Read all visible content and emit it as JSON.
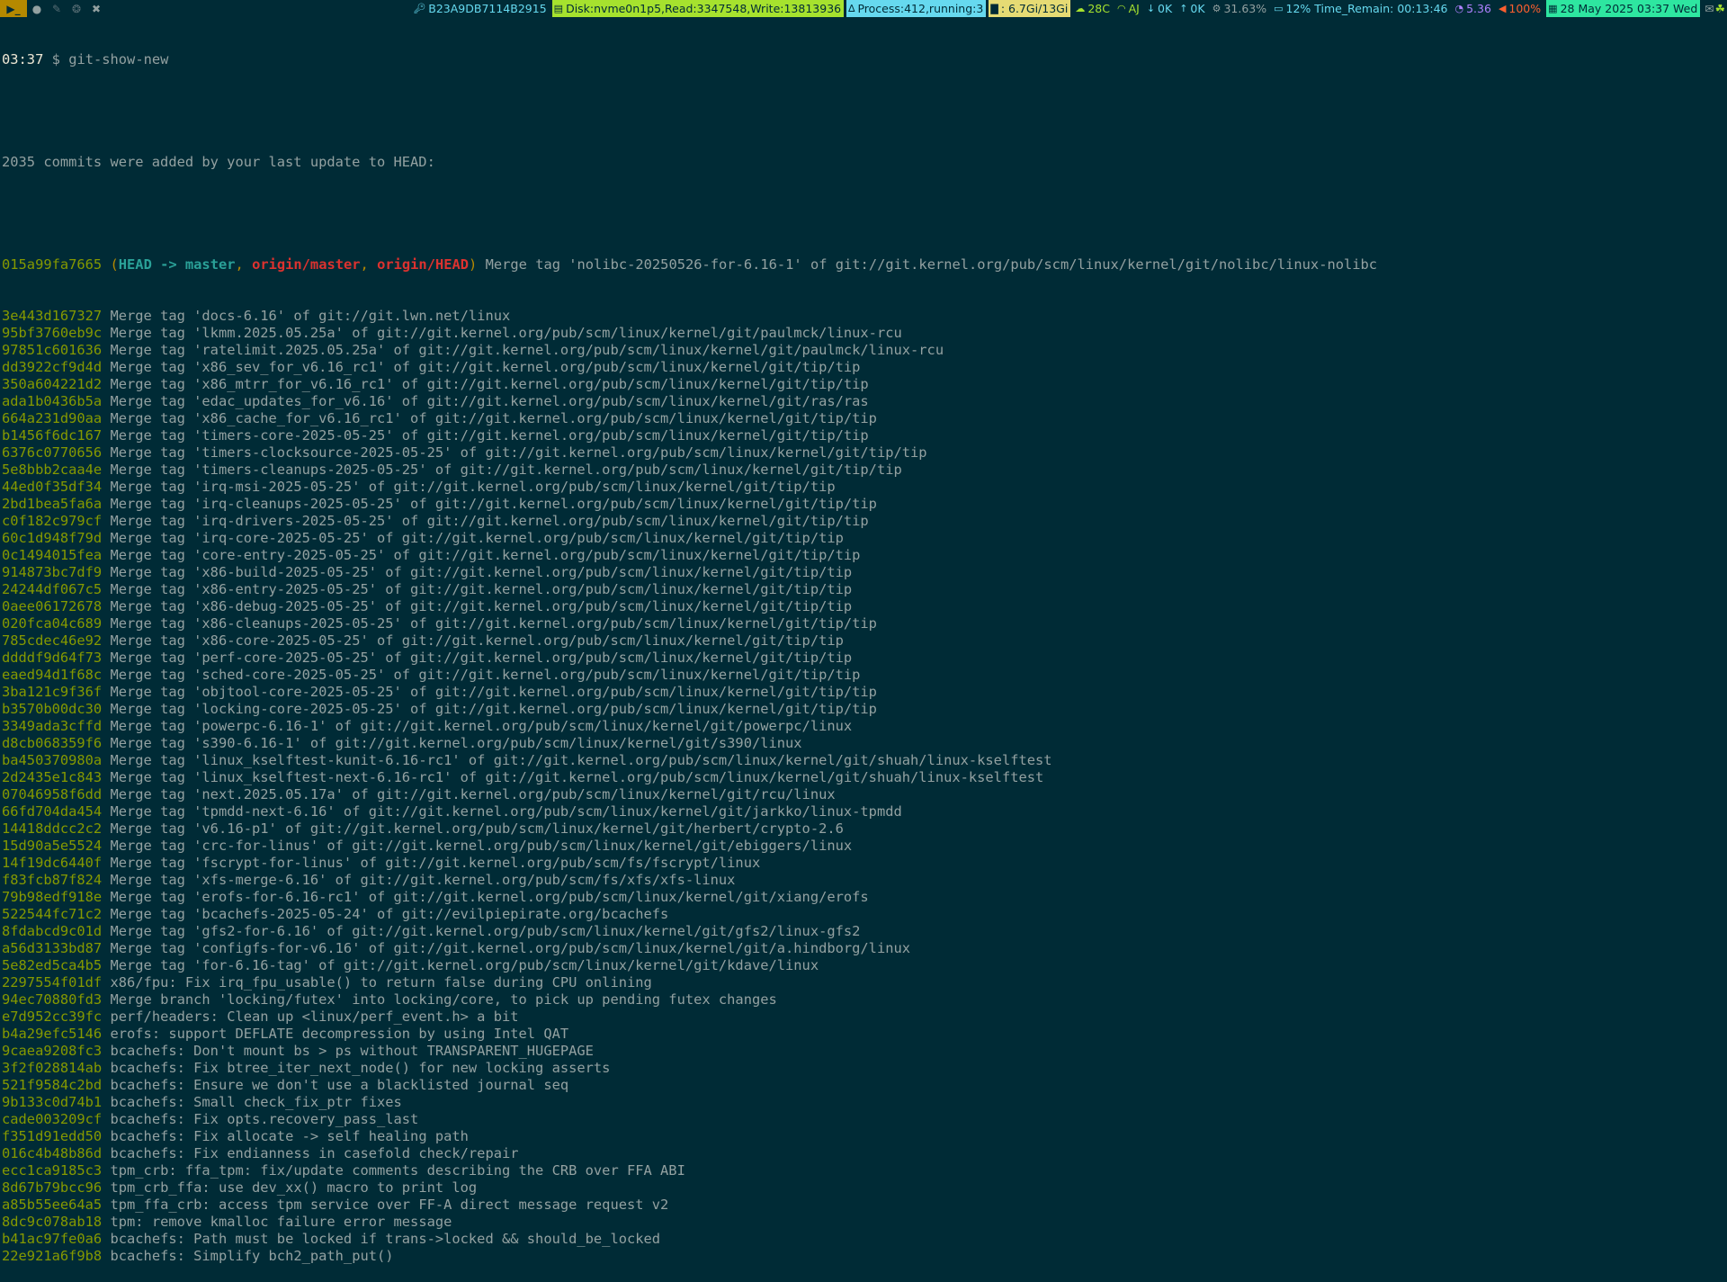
{
  "statusbar": {
    "workspaces": [
      {
        "glyph": "▶_",
        "state": "active",
        "icon": "terminal-icon"
      },
      {
        "glyph": "●",
        "state": "idle",
        "icon": "browser-icon"
      },
      {
        "glyph": "✎",
        "state": "dim",
        "icon": "editor-icon"
      },
      {
        "glyph": "❂",
        "state": "dim",
        "icon": "linux-icon"
      },
      {
        "glyph": "✖",
        "state": "idle",
        "icon": "tools-icon"
      }
    ],
    "key_id": "B23A9DB7114B2915",
    "disk": "Disk:nvme0n1p5,Read:3347548,Write:13813936",
    "process": "Process:412,running:3",
    "memory": ": 6.7Gi/13Gi",
    "temperature": "28C",
    "wifi": "AJ",
    "net_down": "0K",
    "net_up": "0K",
    "cpu": "31.63%",
    "battery": "12% Time_Remain: 00:13:46",
    "load": "5.36",
    "volume": "100%",
    "datetime": "28 May 2025 03:37 Wed",
    "colors": {
      "disk_bg": "#a6e22e",
      "process_bg": "#66d9ef",
      "memory_bg": "#e6db74",
      "datetime_bg": "#2ee6a0"
    }
  },
  "terminal": {
    "prompt_time": "03:37",
    "prompt_symbol": "$",
    "command": "git-show-new",
    "summary": "2035 commits were added by your last update to HEAD:",
    "head_commit": {
      "hash": "015a99fa7665",
      "open": "(",
      "head": "HEAD -> master",
      "sep1": ",",
      "remote1": "origin/master",
      "sep2": ",",
      "remote2": "origin/HEAD",
      "close": ")",
      "message": "Merge tag 'nolibc-20250526-for-6.16-1' of git://git.kernel.org/pub/scm/linux/kernel/git/nolibc/linux-nolibc"
    },
    "commits": [
      {
        "hash": "3e443d167327",
        "message": "Merge tag 'docs-6.16' of git://git.lwn.net/linux"
      },
      {
        "hash": "95bf3760eb9c",
        "message": "Merge tag 'lkmm.2025.05.25a' of git://git.kernel.org/pub/scm/linux/kernel/git/paulmck/linux-rcu"
      },
      {
        "hash": "97851c601636",
        "message": "Merge tag 'ratelimit.2025.05.25a' of git://git.kernel.org/pub/scm/linux/kernel/git/paulmck/linux-rcu"
      },
      {
        "hash": "dd3922cf9d4d",
        "message": "Merge tag 'x86_sev_for_v6.16_rc1' of git://git.kernel.org/pub/scm/linux/kernel/git/tip/tip"
      },
      {
        "hash": "350a604221d2",
        "message": "Merge tag 'x86_mtrr_for_v6.16_rc1' of git://git.kernel.org/pub/scm/linux/kernel/git/tip/tip"
      },
      {
        "hash": "ada1b0436b5a",
        "message": "Merge tag 'edac_updates_for_v6.16' of git://git.kernel.org/pub/scm/linux/kernel/git/ras/ras"
      },
      {
        "hash": "664a231d90aa",
        "message": "Merge tag 'x86_cache_for_v6.16_rc1' of git://git.kernel.org/pub/scm/linux/kernel/git/tip/tip"
      },
      {
        "hash": "b1456f6dc167",
        "message": "Merge tag 'timers-core-2025-05-25' of git://git.kernel.org/pub/scm/linux/kernel/git/tip/tip"
      },
      {
        "hash": "6376c0770656",
        "message": "Merge tag 'timers-clocksource-2025-05-25' of git://git.kernel.org/pub/scm/linux/kernel/git/tip/tip"
      },
      {
        "hash": "5e8bbb2caa4e",
        "message": "Merge tag 'timers-cleanups-2025-05-25' of git://git.kernel.org/pub/scm/linux/kernel/git/tip/tip"
      },
      {
        "hash": "44ed0f35df34",
        "message": "Merge tag 'irq-msi-2025-05-25' of git://git.kernel.org/pub/scm/linux/kernel/git/tip/tip"
      },
      {
        "hash": "2bd1bea5fa6a",
        "message": "Merge tag 'irq-cleanups-2025-05-25' of git://git.kernel.org/pub/scm/linux/kernel/git/tip/tip"
      },
      {
        "hash": "c0f182c979cf",
        "message": "Merge tag 'irq-drivers-2025-05-25' of git://git.kernel.org/pub/scm/linux/kernel/git/tip/tip"
      },
      {
        "hash": "60c1d948f79d",
        "message": "Merge tag 'irq-core-2025-05-25' of git://git.kernel.org/pub/scm/linux/kernel/git/tip/tip"
      },
      {
        "hash": "0c1494015fea",
        "message": "Merge tag 'core-entry-2025-05-25' of git://git.kernel.org/pub/scm/linux/kernel/git/tip/tip"
      },
      {
        "hash": "914873bc7df9",
        "message": "Merge tag 'x86-build-2025-05-25' of git://git.kernel.org/pub/scm/linux/kernel/git/tip/tip"
      },
      {
        "hash": "24244df067c5",
        "message": "Merge tag 'x86-entry-2025-05-25' of git://git.kernel.org/pub/scm/linux/kernel/git/tip/tip"
      },
      {
        "hash": "0aee06172678",
        "message": "Merge tag 'x86-debug-2025-05-25' of git://git.kernel.org/pub/scm/linux/kernel/git/tip/tip"
      },
      {
        "hash": "020fca04c689",
        "message": "Merge tag 'x86-cleanups-2025-05-25' of git://git.kernel.org/pub/scm/linux/kernel/git/tip/tip"
      },
      {
        "hash": "785cdec46e92",
        "message": "Merge tag 'x86-core-2025-05-25' of git://git.kernel.org/pub/scm/linux/kernel/git/tip/tip"
      },
      {
        "hash": "ddddf9d64f73",
        "message": "Merge tag 'perf-core-2025-05-25' of git://git.kernel.org/pub/scm/linux/kernel/git/tip/tip"
      },
      {
        "hash": "eaed94d1f68c",
        "message": "Merge tag 'sched-core-2025-05-25' of git://git.kernel.org/pub/scm/linux/kernel/git/tip/tip"
      },
      {
        "hash": "3ba121c9f36f",
        "message": "Merge tag 'objtool-core-2025-05-25' of git://git.kernel.org/pub/scm/linux/kernel/git/tip/tip"
      },
      {
        "hash": "b3570b00dc30",
        "message": "Merge tag 'locking-core-2025-05-25' of git://git.kernel.org/pub/scm/linux/kernel/git/tip/tip"
      },
      {
        "hash": "3349ada3cffd",
        "message": "Merge tag 'powerpc-6.16-1' of git://git.kernel.org/pub/scm/linux/kernel/git/powerpc/linux"
      },
      {
        "hash": "d8cb068359f6",
        "message": "Merge tag 's390-6.16-1' of git://git.kernel.org/pub/scm/linux/kernel/git/s390/linux"
      },
      {
        "hash": "ba450370980a",
        "message": "Merge tag 'linux_kselftest-kunit-6.16-rc1' of git://git.kernel.org/pub/scm/linux/kernel/git/shuah/linux-kselftest"
      },
      {
        "hash": "2d2435e1c843",
        "message": "Merge tag 'linux_kselftest-next-6.16-rc1' of git://git.kernel.org/pub/scm/linux/kernel/git/shuah/linux-kselftest"
      },
      {
        "hash": "07046958f6dd",
        "message": "Merge tag 'next.2025.05.17a' of git://git.kernel.org/pub/scm/linux/kernel/git/rcu/linux"
      },
      {
        "hash": "66fd704da454",
        "message": "Merge tag 'tpmdd-next-6.16' of git://git.kernel.org/pub/scm/linux/kernel/git/jarkko/linux-tpmdd"
      },
      {
        "hash": "14418ddcc2c2",
        "message": "Merge tag 'v6.16-p1' of git://git.kernel.org/pub/scm/linux/kernel/git/herbert/crypto-2.6"
      },
      {
        "hash": "15d90a5e5524",
        "message": "Merge tag 'crc-for-linus' of git://git.kernel.org/pub/scm/linux/kernel/git/ebiggers/linux"
      },
      {
        "hash": "14f19dc6440f",
        "message": "Merge tag 'fscrypt-for-linus' of git://git.kernel.org/pub/scm/fs/fscrypt/linux"
      },
      {
        "hash": "f83fcb87f824",
        "message": "Merge tag 'xfs-merge-6.16' of git://git.kernel.org/pub/scm/fs/xfs/xfs-linux"
      },
      {
        "hash": "79b98edf918e",
        "message": "Merge tag 'erofs-for-6.16-rc1' of git://git.kernel.org/pub/scm/linux/kernel/git/xiang/erofs"
      },
      {
        "hash": "522544fc71c2",
        "message": "Merge tag 'bcachefs-2025-05-24' of git://evilpiepirate.org/bcachefs"
      },
      {
        "hash": "8fdabcd9c01d",
        "message": "Merge tag 'gfs2-for-6.16' of git://git.kernel.org/pub/scm/linux/kernel/git/gfs2/linux-gfs2"
      },
      {
        "hash": "a56d3133bd87",
        "message": "Merge tag 'configfs-for-v6.16' of git://git.kernel.org/pub/scm/linux/kernel/git/a.hindborg/linux"
      },
      {
        "hash": "5e82ed5ca4b5",
        "message": "Merge tag 'for-6.16-tag' of git://git.kernel.org/pub/scm/linux/kernel/git/kdave/linux"
      },
      {
        "hash": "2297554f01df",
        "message": "x86/fpu: Fix irq_fpu_usable() to return false during CPU onlining"
      },
      {
        "hash": "94ec70880fd3",
        "message": "Merge branch 'locking/futex' into locking/core, to pick up pending futex changes"
      },
      {
        "hash": "e7d952cc39fc",
        "message": "perf/headers: Clean up <linux/perf_event.h> a bit"
      },
      {
        "hash": "b4a29efc5146",
        "message": "erofs: support DEFLATE decompression by using Intel QAT"
      },
      {
        "hash": "9caea9208fc3",
        "message": "bcachefs: Don't mount bs > ps without TRANSPARENT_HUGEPAGE"
      },
      {
        "hash": "3f2f028814ab",
        "message": "bcachefs: Fix btree_iter_next_node() for new locking asserts"
      },
      {
        "hash": "521f9584c2bd",
        "message": "bcachefs: Ensure we don't use a blacklisted journal seq"
      },
      {
        "hash": "9b133c0d74b1",
        "message": "bcachefs: Small check_fix_ptr fixes"
      },
      {
        "hash": "cade003209cf",
        "message": "bcachefs: Fix opts.recovery_pass_last"
      },
      {
        "hash": "f351d91edd50",
        "message": "bcachefs: Fix allocate -> self healing path"
      },
      {
        "hash": "016c4b48b86d",
        "message": "bcachefs: Fix endianness in casefold check/repair"
      },
      {
        "hash": "ecc1ca9185c3",
        "message": "tpm_crb: ffa_tpm: fix/update comments describing the CRB over FFA ABI"
      },
      {
        "hash": "8d67b79bcc96",
        "message": "tpm_crb_ffa: use dev_xx() macro to print log"
      },
      {
        "hash": "a85b55ee64a5",
        "message": "tpm_ffa_crb: access tpm service over FF-A direct message request v2"
      },
      {
        "hash": "8dc9c078ab18",
        "message": "tpm: remove kmalloc failure error message"
      },
      {
        "hash": "b41ac97fe0a6",
        "message": "bcachefs: Path must be locked if trans->locked && should_be_locked"
      },
      {
        "hash": "22e921a6f9b8",
        "message": "bcachefs: Simplify bch2_path_put()"
      }
    ]
  }
}
